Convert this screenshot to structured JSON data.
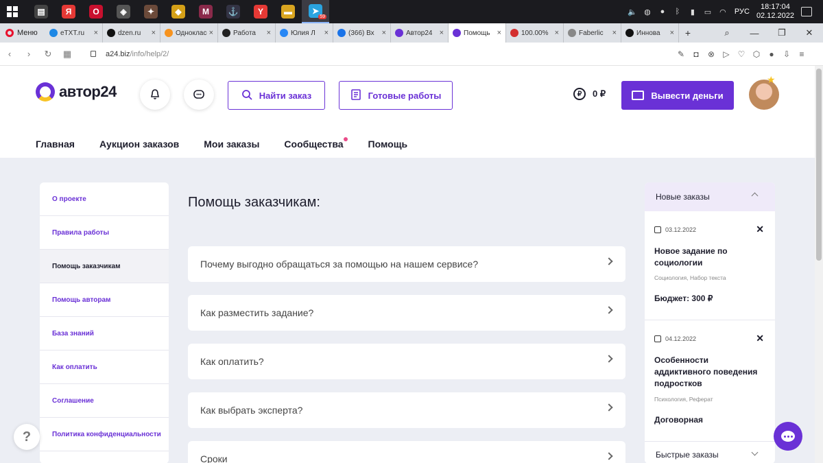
{
  "taskbar": {
    "apps": [
      {
        "name": "task-view",
        "glyph": "▤",
        "color": "#444"
      },
      {
        "name": "yandex",
        "glyph": "Я",
        "color": "#e53935"
      },
      {
        "name": "opera",
        "glyph": "O",
        "color": "#c8102e"
      },
      {
        "name": "world-of-tanks",
        "glyph": "◈",
        "color": "#555"
      },
      {
        "name": "game",
        "glyph": "✦",
        "color": "#6b4a3a"
      },
      {
        "name": "binance",
        "glyph": "◆",
        "color": "#d4a017"
      },
      {
        "name": "app-m",
        "glyph": "M",
        "color": "#8a2a4a"
      },
      {
        "name": "warships",
        "glyph": "⚓",
        "color": "#334"
      },
      {
        "name": "yandex-browser",
        "glyph": "Y",
        "color": "#e53935"
      },
      {
        "name": "file-explorer",
        "glyph": "▬",
        "color": "#d9a520"
      },
      {
        "name": "telegram",
        "glyph": "➤",
        "color": "#2aa3e0",
        "badge": "59"
      }
    ],
    "lang": "РУС",
    "time": "18:17:04",
    "date": "02.12.2022"
  },
  "browser": {
    "menu_label": "Меню",
    "tabs": [
      {
        "label": "eTXT.ru",
        "color": "#1e88e5"
      },
      {
        "label": "dzen.ru",
        "color": "#111"
      },
      {
        "label": "Одноклассники",
        "color": "#f7931e"
      },
      {
        "label": "Работа",
        "color": "#222"
      },
      {
        "label": "Юлия Л",
        "color": "#2787f5"
      },
      {
        "label": "(366) Вх",
        "color": "#1a73e8"
      },
      {
        "label": "Автор24",
        "color": "#6a31d6"
      },
      {
        "label": "Помощь",
        "color": "#6a31d6",
        "active": true
      },
      {
        "label": "100.00%",
        "color": "#d32f2f"
      },
      {
        "label": "Faberlic",
        "color": "#888"
      },
      {
        "label": "Иннова",
        "color": "#111"
      }
    ],
    "url_host": "a24.biz",
    "url_path": "/info/help/2/"
  },
  "site": {
    "logo_text": "автор24",
    "find_order": "Найти заказ",
    "ready_works": "Готовые работы",
    "balance": "0 ₽",
    "balance_symbol": "₽",
    "withdraw": "Вывести деньги",
    "nav": [
      "Главная",
      "Аукцион заказов",
      "Мои заказы",
      "Сообщества",
      "Помощь"
    ],
    "accent": "#6a31d6"
  },
  "sidebar": {
    "items": [
      "О проекте",
      "Правила работы",
      "Помощь заказчикам",
      "Помощь авторам",
      "База знаний",
      "Как оплатить",
      "Соглашение",
      "Политика конфиденциальности"
    ],
    "current_index": 2
  },
  "content": {
    "title": "Помощь заказчикам:",
    "faq": [
      "Почему выгодно обращаться за помощью на нашем сервисе?",
      "Как разместить задание?",
      "Как оплатить?",
      "Как выбрать эксперта?",
      "Сроки"
    ]
  },
  "right_panel": {
    "header": "Новые заказы",
    "orders": [
      {
        "date": "03.12.2022",
        "title": "Новое задание по социологии",
        "tags": "Социология, Набор текста",
        "budget": "Бюджет: 300 ₽"
      },
      {
        "date": "04.12.2022",
        "title": "Особенности аддиктивного поведения подростков",
        "tags": "Психология, Реферат",
        "budget": "Договорная"
      }
    ],
    "footer": "Быстрые заказы"
  },
  "widgets": {
    "help_glyph": "?"
  }
}
